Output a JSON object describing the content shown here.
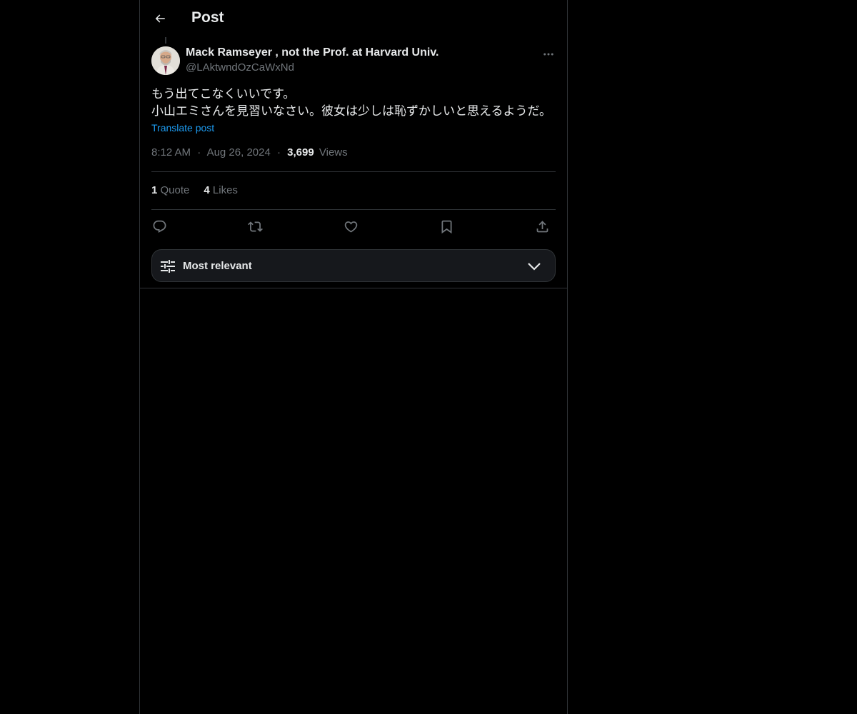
{
  "header": {
    "title": "Post",
    "back_icon": "arrow-left-icon"
  },
  "post": {
    "author": {
      "name": "Mack Ramseyer , not the Prof. at Harvard Univ.",
      "handle": "@LAktwndOzCaWxNd"
    },
    "text_lines": [
      "もう出てこなくいいです。",
      "小山エミさんを見習いなさい。彼女は少しは恥ずかしいと思えるようだ。"
    ],
    "translate_label": "Translate post",
    "time": "8:12 AM",
    "date": "Aug 26, 2024",
    "separator": "·",
    "views_count": "3,699",
    "views_label": "Views",
    "quotes_count": "1",
    "quotes_label": "Quote",
    "likes_count": "4",
    "likes_label": "Likes"
  },
  "actions": {
    "icons": [
      "reply-icon",
      "repost-icon",
      "like-icon",
      "bookmark-icon",
      "share-icon"
    ]
  },
  "sort": {
    "label": "Most relevant",
    "icon": "sliders-icon",
    "chevron": "chevron-down-icon"
  },
  "colors": {
    "background": "#000000",
    "text": "#e7e9ea",
    "muted": "#71767b",
    "accent": "#1d9bf0",
    "border": "#2f3336"
  }
}
